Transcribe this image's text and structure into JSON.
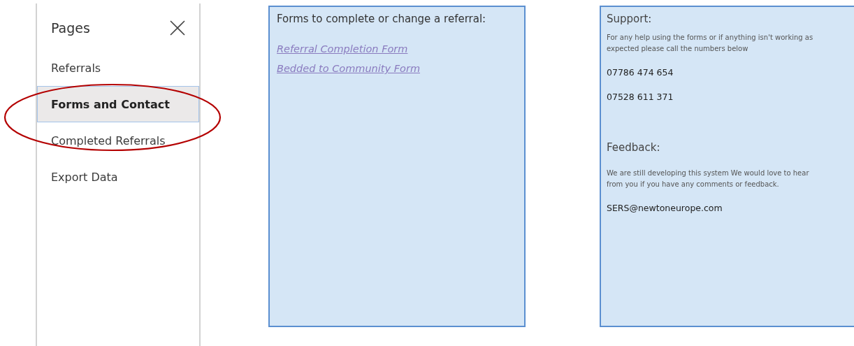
{
  "sidebar": {
    "title": "Pages",
    "items": [
      {
        "label": "Referrals",
        "selected": false
      },
      {
        "label": "Forms and Contact",
        "selected": true
      },
      {
        "label": "Completed Referrals",
        "selected": false
      },
      {
        "label": "Export Data",
        "selected": false
      }
    ]
  },
  "forms_panel": {
    "heading": "Forms to complete or change a referral:",
    "links": [
      "Referral Completion Form",
      "Bedded to Community Form"
    ]
  },
  "support_panel": {
    "heading": "Support:",
    "text": "For any help using the forms or if anything isn't working as expected please call the numbers below",
    "phones": [
      "07786 474 654",
      "07528 611 371"
    ],
    "feedback_heading": "Feedback:",
    "feedback_text": "We are still developing this system We would love to hear from you if you have any comments or feedback.",
    "email": "SERS@newtoneurope.com"
  }
}
